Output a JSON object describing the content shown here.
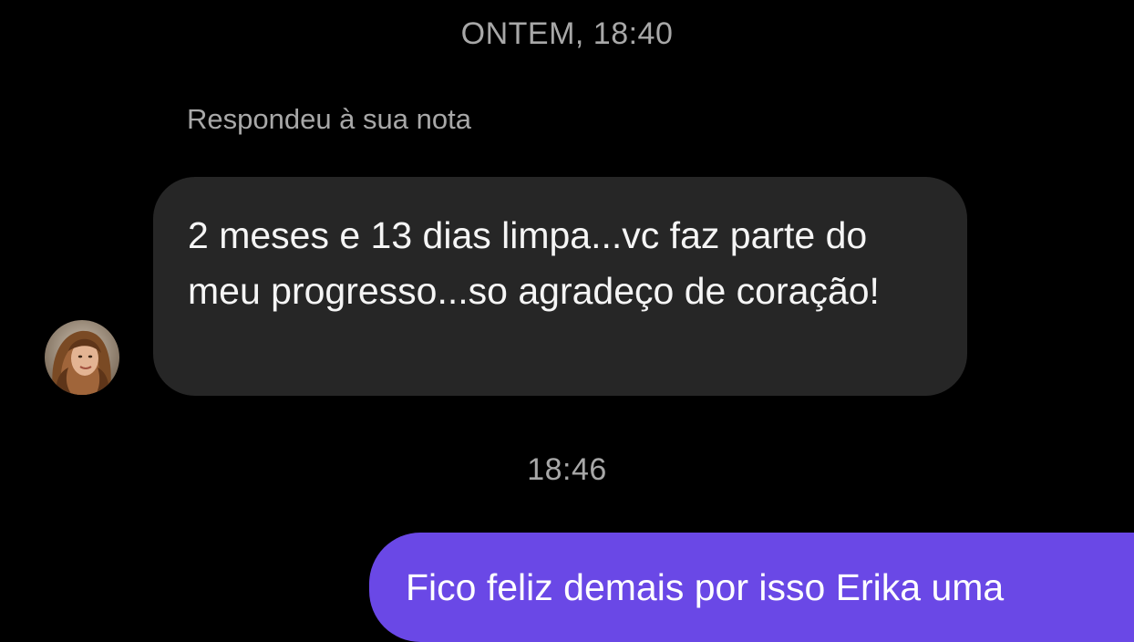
{
  "thread": {
    "date_separator": "ONTEM, 18:40",
    "time_separator": "18:46"
  },
  "incoming_message": {
    "reply_context": "Respondeu à sua nota",
    "text": "2 meses e 13 dias limpa...vc faz parte do meu progresso...so agradeço de coração!",
    "avatar_icon": "profile-photo"
  },
  "outgoing_message": {
    "text": "Fico feliz demais por isso Erika uma",
    "bubble_color": "#6a48e6"
  },
  "colors": {
    "background": "#000000",
    "incoming_bubble": "#262626",
    "secondary_text": "#a8a8a8"
  }
}
